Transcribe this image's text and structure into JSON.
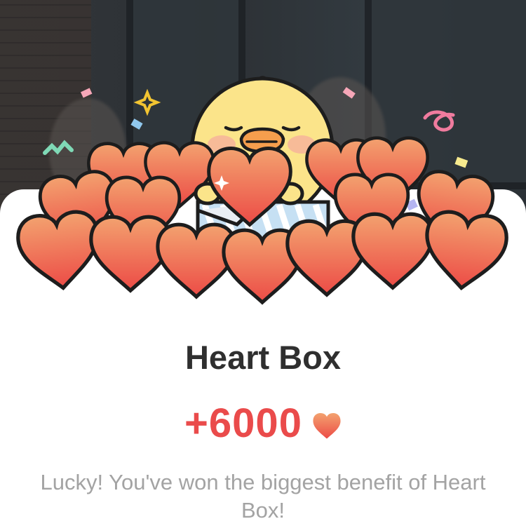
{
  "modal": {
    "title": "Heart Box",
    "reward_amount": "+6000",
    "reward_icon": "heart-icon",
    "message": "Lucky! You've won the biggest benefit of Heart Box!"
  },
  "illustration": {
    "subject": "chick-with-hearts-icon"
  },
  "colors": {
    "accent": "#ea4b4b",
    "title": "#2f2f2f",
    "message": "#a3a3a3",
    "heart_top": "#f2a06e",
    "heart_bottom": "#ec4d47",
    "chick": "#fbe48a"
  }
}
